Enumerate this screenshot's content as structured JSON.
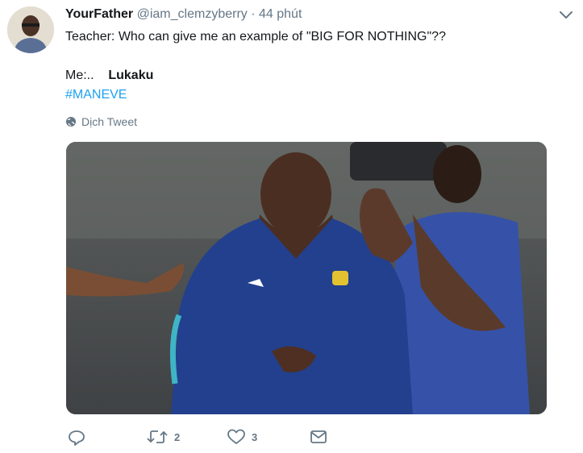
{
  "tweet": {
    "display_name": "YourFather",
    "handle": "@iam_clemzyberry",
    "separator": "·",
    "time": "44 phút",
    "line1": "Teacher: Who can give me an example of \"BIG FOR NOTHING\"??",
    "line2_prefix": "Me:..",
    "line2_bold": "Lukaku",
    "hashtag": "#MANEVE",
    "translate_label": "Dịch Tweet"
  },
  "actions": {
    "retweet_count": "2",
    "like_count": "3"
  },
  "colors": {
    "link": "#1da1f2",
    "secondary": "#657786",
    "jacket": "#1f3f8f"
  },
  "icons": [
    "chevron-down-icon",
    "globe-icon",
    "reply-icon",
    "retweet-icon",
    "like-icon",
    "dm-icon"
  ]
}
